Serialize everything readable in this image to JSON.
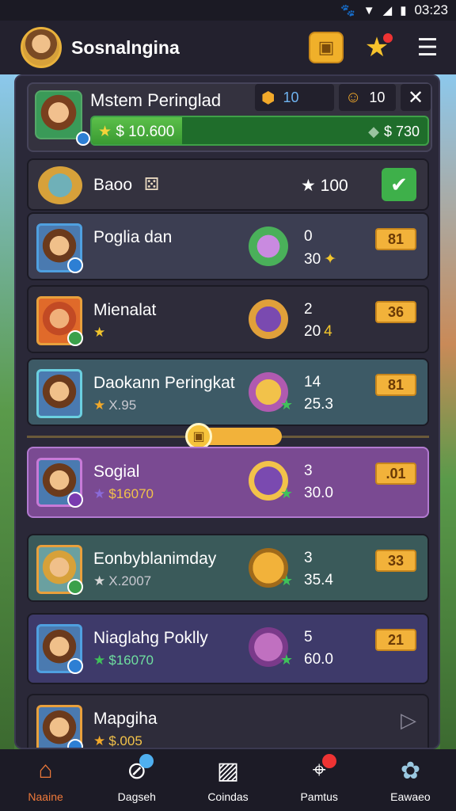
{
  "status": {
    "time": "03:23"
  },
  "topbar": {
    "title": "Sosnalngina"
  },
  "header": {
    "name": "Mstem Peringlad",
    "chip1": "10",
    "chip2": "10",
    "progress_left": "$ 10.600",
    "progress_right": "$ 730",
    "progress_fraction": 0.27
  },
  "first_row": {
    "name": "Baoo",
    "value": "100"
  },
  "rows": [
    {
      "name": "Poglia dan",
      "sub": "",
      "n1": "0",
      "n2": "30",
      "badge": "81"
    },
    {
      "name": "Mienalat",
      "sub": "",
      "n1": "2",
      "n2": "20",
      "badge": "36"
    },
    {
      "name": "Daokann Peringkat",
      "sub": "X.95",
      "n1": "14",
      "n2": "25.3",
      "badge": "81"
    },
    {
      "name": "Sogial",
      "sub": "$16070",
      "n1": "3",
      "n2": "30.0",
      "badge": ".01"
    },
    {
      "name": "Eonbyblanimday",
      "sub": "X.2007",
      "n1": "3",
      "n2": "35.4",
      "badge": "33"
    },
    {
      "name": "Niaglahg Poklly",
      "sub": "$16070",
      "n1": "5",
      "n2": "60.0",
      "badge": "21"
    },
    {
      "name": "Mapgiha",
      "sub": "$.005",
      "n1": "",
      "n2": "",
      "badge": ""
    }
  ],
  "nav": [
    {
      "label": "Naaine",
      "icon": "home-icon"
    },
    {
      "label": "Dagseh",
      "icon": "compass-icon"
    },
    {
      "label": "Coindas",
      "icon": "chart-icon"
    },
    {
      "label": "Pamtus",
      "icon": "shop-icon"
    },
    {
      "label": "Eawaeo",
      "icon": "team-icon"
    }
  ]
}
